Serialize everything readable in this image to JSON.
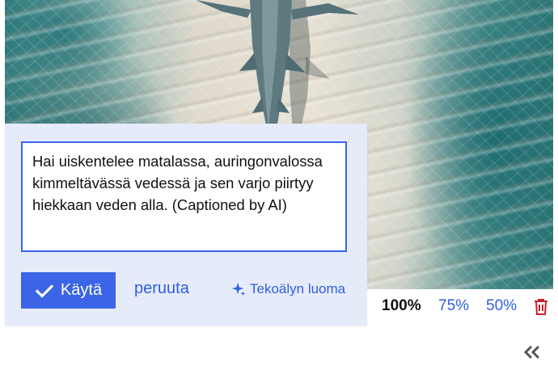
{
  "caption": {
    "text": "Hai uiskentelee matalassa, auringonvalossa kimmeltävässä vedessä ja sen varjo piirtyy hiekkaan veden alla. (Captioned by AI)"
  },
  "actions": {
    "apply_label": "Käytä",
    "cancel_label": "peruuta",
    "ai_label": "Tekoälyn luoma"
  },
  "zoom": {
    "options": [
      "100%",
      "75%",
      "50%"
    ],
    "selected": "100%"
  },
  "icons": {
    "apply": "check-icon",
    "ai": "sparkle-icon",
    "delete": "trash-icon",
    "collapse": "double-chevron-left-icon"
  },
  "colors": {
    "accent": "#3b64e6",
    "panel_bg": "#e6ebfa",
    "delete": "#c8202a"
  }
}
